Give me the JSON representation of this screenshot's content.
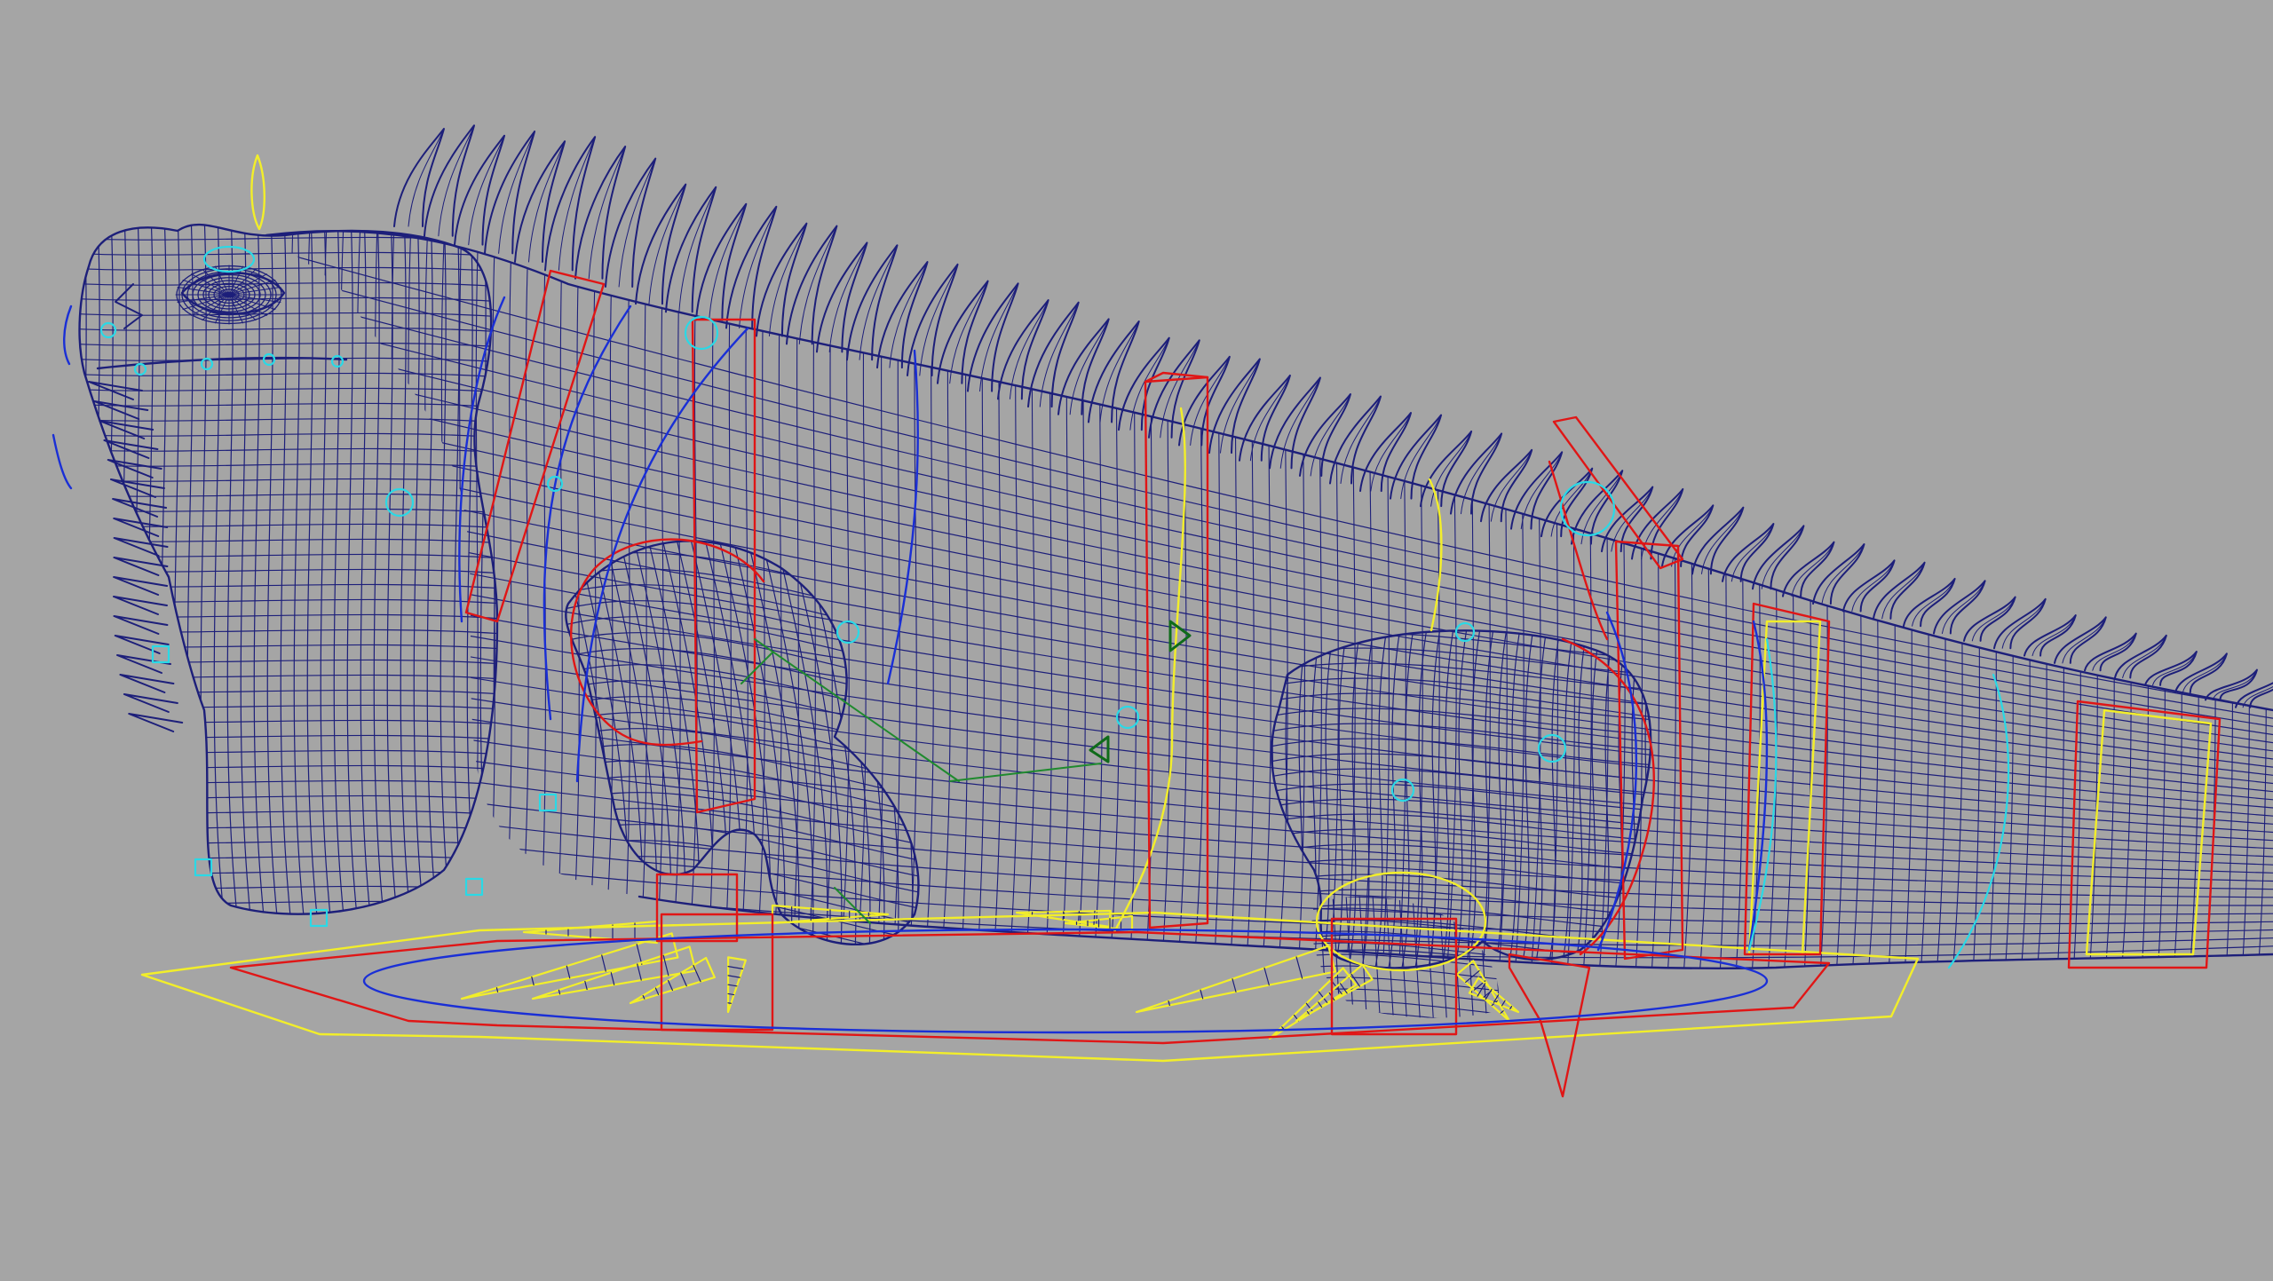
{
  "viewport": {
    "background": "#a5a5a5",
    "subject": "iguana-rig",
    "display_mode": "wireframe"
  },
  "colors": {
    "mesh": "#1d1f7a",
    "controls_red": "#e01616",
    "controls_yellow": "#f2ee2a",
    "controls_blue": "#1a2fd6",
    "controls_cyan": "#2ad9e6",
    "controls_green": "#1f8a2e",
    "pivot_green": "#0f6b1a"
  }
}
